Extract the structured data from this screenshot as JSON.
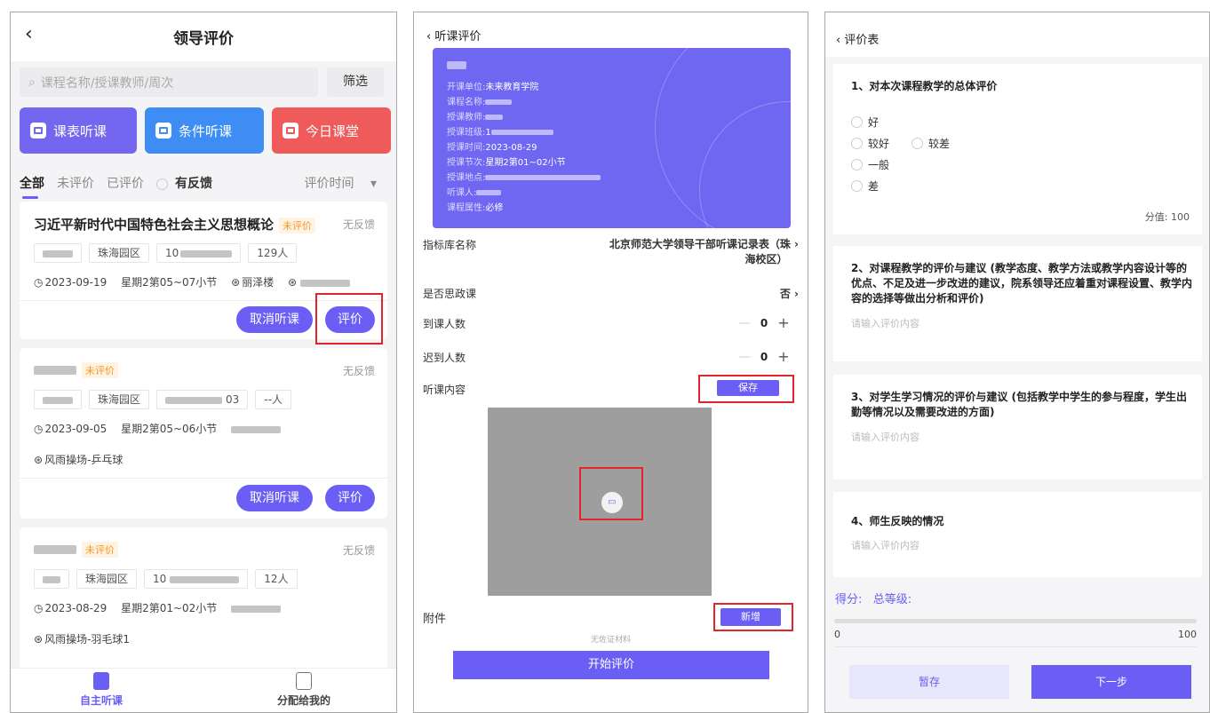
{
  "panel1": {
    "title": "领导评价",
    "search_placeholder": "课程名称/授课教师/周次",
    "filter_label": "筛选",
    "quick_buttons": [
      {
        "label": "课表听课",
        "color": "#7367f0"
      },
      {
        "label": "条件听课",
        "color": "#3d8df5"
      },
      {
        "label": "今日课堂",
        "color": "#ef5b5b"
      }
    ],
    "filter_tabs": [
      "全部",
      "未评价",
      "已评价"
    ],
    "feedback_filter": "有反馈",
    "sort_label": "评价时间",
    "cards": [
      {
        "title": "习近平新时代中国特色社会主义思想概论",
        "status": "未评价",
        "feedback": "无反馈",
        "campus": "珠海园区",
        "class_code": "10",
        "count": "129人",
        "date": "2023-09-19",
        "period": "星期2第05~07小节",
        "building": "丽泽楼",
        "location": "",
        "cancel": "取消听课",
        "evaluate": "评价"
      },
      {
        "title": "",
        "status": "未评价",
        "feedback": "无反馈",
        "campus": "珠海园区",
        "class_code": "03",
        "count": "--人",
        "date": "2023-09-05",
        "period": "星期2第05~06小节",
        "building": "",
        "location": "风雨操场-乒乓球",
        "cancel": "取消听课",
        "evaluate": "评价"
      },
      {
        "title": "",
        "status": "未评价",
        "feedback": "无反馈",
        "campus": "珠海园区",
        "class_code": "10",
        "count": "12人",
        "date": "2023-08-29",
        "period": "星期2第01~02小节",
        "building": "",
        "location": "风雨操场-羽毛球1"
      }
    ],
    "tabbar": [
      "自主听课",
      "分配给我的"
    ]
  },
  "panel2": {
    "back_title": "听课评价",
    "info": {
      "unit_label": "开课单位:",
      "unit": "未来教育学院",
      "course_label": "课程名称:",
      "teacher_label": "授课教师:",
      "class_label": "授课班级:",
      "class_value": "1",
      "time_label": "授课时间:",
      "time": "2023-08-29",
      "period_label": "授课节次:",
      "period": "星期2第01~02小节",
      "place_label": "授课地点:",
      "listener_label": "听课人:",
      "attr_label": "课程属性:",
      "attr": "必修"
    },
    "index_label": "指标库名称",
    "index_value_1": "北京师范大学领导干部听课记录表（珠",
    "index_value_2": "海校区）",
    "ideology_label": "是否思政课",
    "ideology_value": "否",
    "arrive_label": "到课人数",
    "arrive_value": "0",
    "late_label": "迟到人数",
    "late_value": "0",
    "content_label": "听课内容",
    "save_label": "保存",
    "attach_label": "附件",
    "add_label": "新增",
    "no_material": "无佐证材料",
    "start_label": "开始评价"
  },
  "panel3": {
    "back_title": "评价表",
    "q1": {
      "title": "1、对本次课程教学的总体评价",
      "options": [
        "好",
        "较好",
        "较差",
        "一般",
        "差"
      ],
      "score_label": "分值: 100"
    },
    "q2": {
      "title": "2、对课程教学的评价与建议 (教学态度、教学方法或教学内容设计等的优点、不足及进一步改进的建议，院系领导还应着重对课程设置、教学内容的选择等做出分析和评价)",
      "placeholder": "请输入评价内容"
    },
    "q3": {
      "title": "3、对学生学习情况的评价与建议 (包括教学中学生的参与程度，学生出勤等情况以及需要改进的方面)",
      "placeholder": "请输入评价内容"
    },
    "q4": {
      "title": "4、师生反映的情况",
      "placeholder": "请输入评价内容"
    },
    "score_label": "得分:",
    "grade_label": "总等级:",
    "progress_min": "0",
    "progress_max": "100",
    "progress_value": 0,
    "temp_save": "暂存",
    "next": "下一步"
  }
}
